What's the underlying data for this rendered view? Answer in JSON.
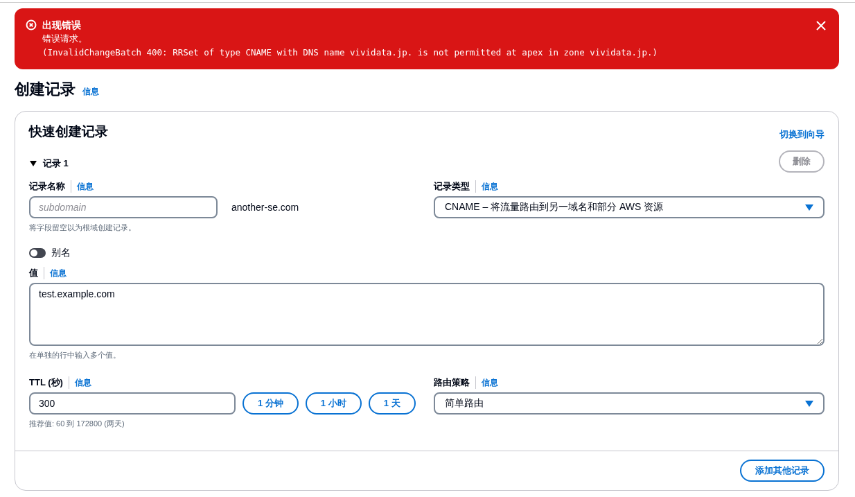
{
  "alert": {
    "title": "出现错误",
    "message": "错误请求。",
    "detail": "(InvalidChangeBatch 400: RRSet of type CNAME with DNS name vividata.jp. is not permitted at apex in zone vividata.jp.)"
  },
  "page": {
    "title": "创建记录",
    "info": "信息"
  },
  "card": {
    "title": "快速创建记录",
    "switch_link": "切换到向导",
    "record": {
      "label": "记录 1",
      "expanded": true,
      "delete_button": {
        "label": "删除",
        "disabled": true
      },
      "name": {
        "label": "记录名称",
        "info": "信息",
        "placeholder": "subdomain",
        "suffix": "another-se.com",
        "hint": "将字段留空以为根域创建记录。"
      },
      "type": {
        "label": "记录类型",
        "info": "信息",
        "value": "CNAME – 将流量路由到另一域名和部分 AWS 资源"
      },
      "alias": {
        "label": "别名",
        "on": false
      },
      "value": {
        "label": "值",
        "info": "信息",
        "value": "test.example.com",
        "hint": "在单独的行中输入多个值。"
      },
      "ttl": {
        "label": "TTL (秒)",
        "info": "信息",
        "value": "300",
        "hint": "推荐值: 60 到 172800 (两天)",
        "presets": [
          "1 分钟",
          "1 小时",
          "1 天"
        ]
      },
      "routing": {
        "label": "路由策略",
        "info": "信息",
        "value": "简单路由"
      }
    },
    "add_button": "添加其他记录"
  }
}
